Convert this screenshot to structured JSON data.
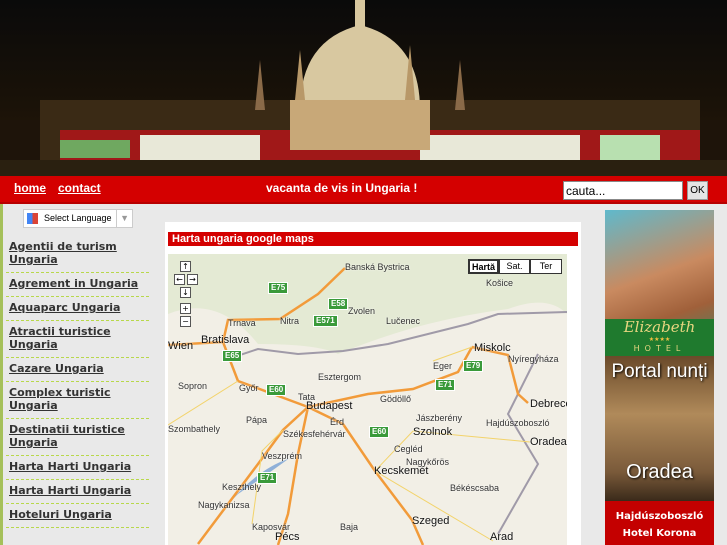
{
  "nav": {
    "home": "home",
    "contact": "contact",
    "slogan": "vacanta de vis in Ungaria !",
    "search_placeholder": "cauta...",
    "ok": "OK"
  },
  "translate": {
    "label": "Select Language",
    "arrow": "▼"
  },
  "menu": [
    "Agentii de turism Ungaria",
    "Agrement in Ungaria",
    "Aquaparc Ungaria",
    "Atractii turistice Ungaria",
    "Cazare Ungaria",
    "Complex turistic Ungaria",
    "Destinatii turistice Ungaria",
    "Harta Harti Ungaria",
    "Harta Harti Ungaria",
    "Hoteluri Ungaria"
  ],
  "content": {
    "title": "Harta ungaria google maps"
  },
  "map": {
    "types": [
      "Hartă",
      "Sat.",
      "Ter"
    ],
    "selected_type": "Hartă",
    "cities_major": [
      "Budapest",
      "Bratislava",
      "Wien",
      "Miskolc",
      "Debrecen",
      "Szeged",
      "Kecskemét",
      "Szolnok",
      "Oradea",
      "Nyíregyháza",
      "Košice",
      "Győr",
      "Székesfehérvár",
      "Kaposvár",
      "Nitra",
      "Trnava",
      "Szombathely",
      "Banská Bystrica"
    ],
    "cities_minor": [
      "Eger",
      "Veszprém",
      "Arad",
      "Pécs",
      "Esztergom",
      "Gödöllő",
      "Jászberény",
      "Cegléd",
      "Nagykőrös",
      "Hajdúszoboszló",
      "Békéscsaba",
      "Keszthely",
      "Nagykanizsa",
      "Sopron",
      "Pápa",
      "Tata",
      "Zvolen",
      "Lučenec",
      "Érd",
      "Baja"
    ],
    "roads": [
      "E75",
      "E58",
      "E571",
      "E65",
      "E60",
      "E71",
      "E79",
      "E60",
      "E71"
    ]
  },
  "ads": {
    "ad1_brand": "Elizabeth",
    "ad1_stars": "★★★★",
    "ad1_sub": "HOTEL",
    "ad2_top": "Portal nunți",
    "ad2_bottom": "Oradea",
    "ad3_line1": "Hajdúszoboszló",
    "ad3_line2": "Hotel Korona"
  },
  "colors": {
    "nav_red": "#d40000",
    "accent_green": "#a5c05a"
  }
}
